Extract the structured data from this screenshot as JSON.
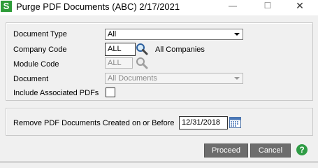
{
  "window": {
    "app_icon_letter": "S",
    "title": "Purge PDF Documents (ABC) 2/17/2021",
    "controls": {
      "minimize": "—",
      "maximize": "☐",
      "close": "✕"
    }
  },
  "form": {
    "document_type": {
      "label": "Document Type",
      "value": "All"
    },
    "company_code": {
      "label": "Company Code",
      "value": "ALL",
      "description": "All Companies"
    },
    "module_code": {
      "label": "Module Code",
      "value": "ALL"
    },
    "document": {
      "label": "Document",
      "value": "All Documents"
    },
    "include_pdfs": {
      "label": "Include Associated PDFs",
      "checked": false
    }
  },
  "purge": {
    "label": "Remove PDF Documents Created on or Before",
    "date": "12/31/2018"
  },
  "buttons": {
    "proceed": "Proceed",
    "cancel": "Cancel",
    "help": "?"
  },
  "colors": {
    "app_icon": "#2e9c39",
    "button_bg": "#6d6d6d",
    "help_icon": "#2f9c45"
  }
}
